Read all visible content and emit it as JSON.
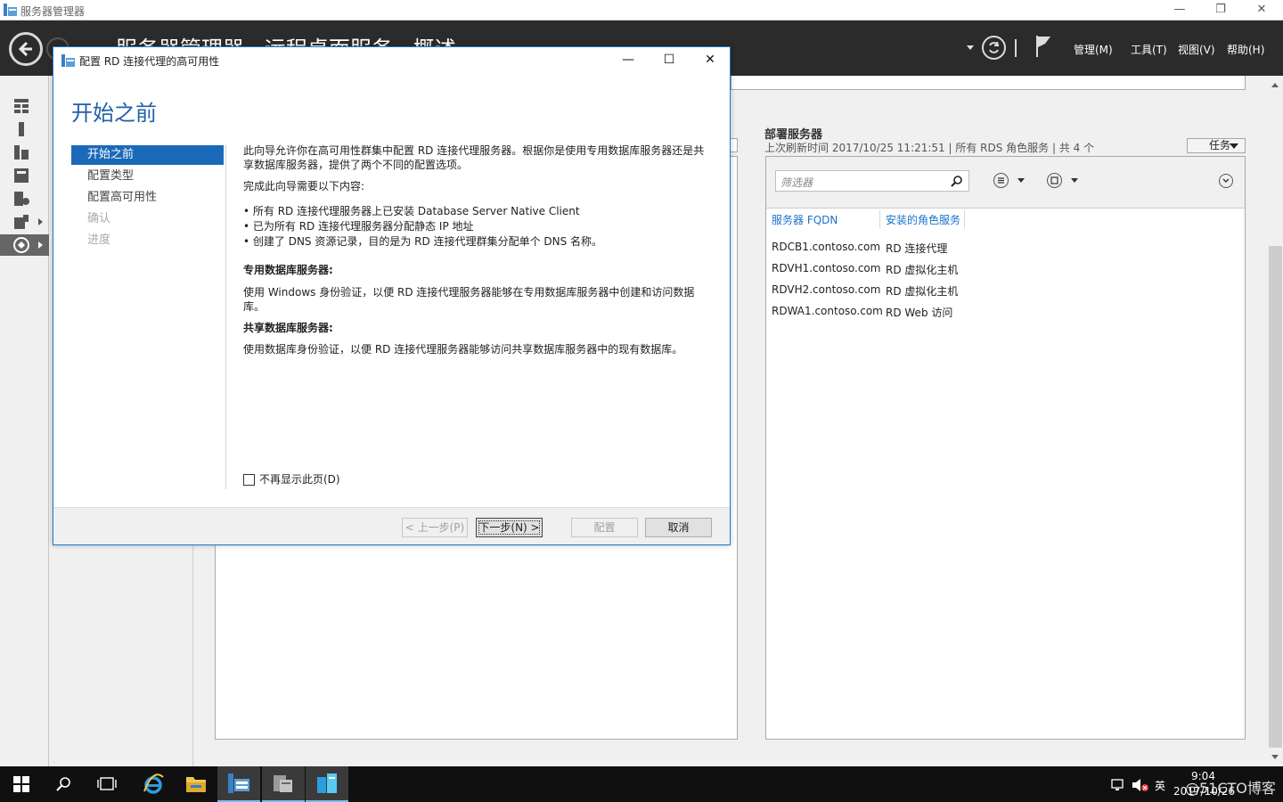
{
  "window": {
    "title": "服务器管理器",
    "minimize_label": "—",
    "restore_label": "❐",
    "close_label": "✕"
  },
  "header": {
    "breadcrumb": "服务器管理器 · 远程桌面服务 · 概述",
    "menu": {
      "manage": "管理(M)",
      "tools": "工具(T)",
      "view": "视图(V)",
      "help": "帮助(H)"
    }
  },
  "deployment": {
    "title": "部署服务器",
    "subtitle": "上次刷新时间 2017/10/25 11:21:51 | 所有 RDS 角色服务 | 共 4 个",
    "tasks_label": "任务",
    "filter_placeholder": "筛选器",
    "columns": [
      "服务器 FQDN",
      "安装的角色服务"
    ],
    "rows": [
      [
        "RDCB1.contoso.com",
        "RD 连接代理"
      ],
      [
        "RDVH1.contoso.com",
        "RD 虚拟化主机"
      ],
      [
        "RDVH2.contoso.com",
        "RD 虚拟化主机"
      ],
      [
        "RDWA1.contoso.com",
        "RD Web 访问"
      ]
    ]
  },
  "dialog": {
    "title": "配置 RD 连接代理的高可用性",
    "minimize_label": "—",
    "maximize_label": "☐",
    "close_label": "✕",
    "header": "开始之前",
    "steps": [
      "开始之前",
      "配置类型",
      "配置高可用性",
      "确认",
      "进度"
    ],
    "intro": "此向导允许你在高可用性群集中配置 RD 连接代理服务器。根据你是使用专用数据库服务器还是共享数据库服务器，提供了两个不同的配置选项。",
    "requirements_heading": "完成此向导需要以下内容:",
    "requirements": [
      "• 所有 RD 连接代理服务器上已安装 Database Server Native Client",
      "• 已为所有 RD 连接代理服务器分配静态 IP 地址",
      "• 创建了 DNS 资源记录，目的是为 RD 连接代理群集分配单个 DNS 名称。"
    ],
    "dedicated_heading": "专用数据库服务器:",
    "dedicated_text": "使用 Windows 身份验证，以便 RD 连接代理服务器能够在专用数据库服务器中创建和访问数据库。",
    "shared_heading": "共享数据库服务器:",
    "shared_text": "使用数据库身份验证，以便 RD 连接代理服务器能够访问共享数据库服务器中的现有数据库。",
    "dont_show": "不再显示此页(D)",
    "buttons": {
      "previous": "< 上一步(P)",
      "next": "下一步(N) >",
      "configure": "配置",
      "cancel": "取消"
    }
  },
  "taskbar": {
    "ime": "英",
    "time": "9:04",
    "date": "2017/10/26",
    "watermark": "@51CTO博客"
  },
  "colors": {
    "header_bg": "#2b2b2b",
    "accent": "#1a6ab9",
    "link": "#1a73c9",
    "taskbar": "#101010"
  }
}
